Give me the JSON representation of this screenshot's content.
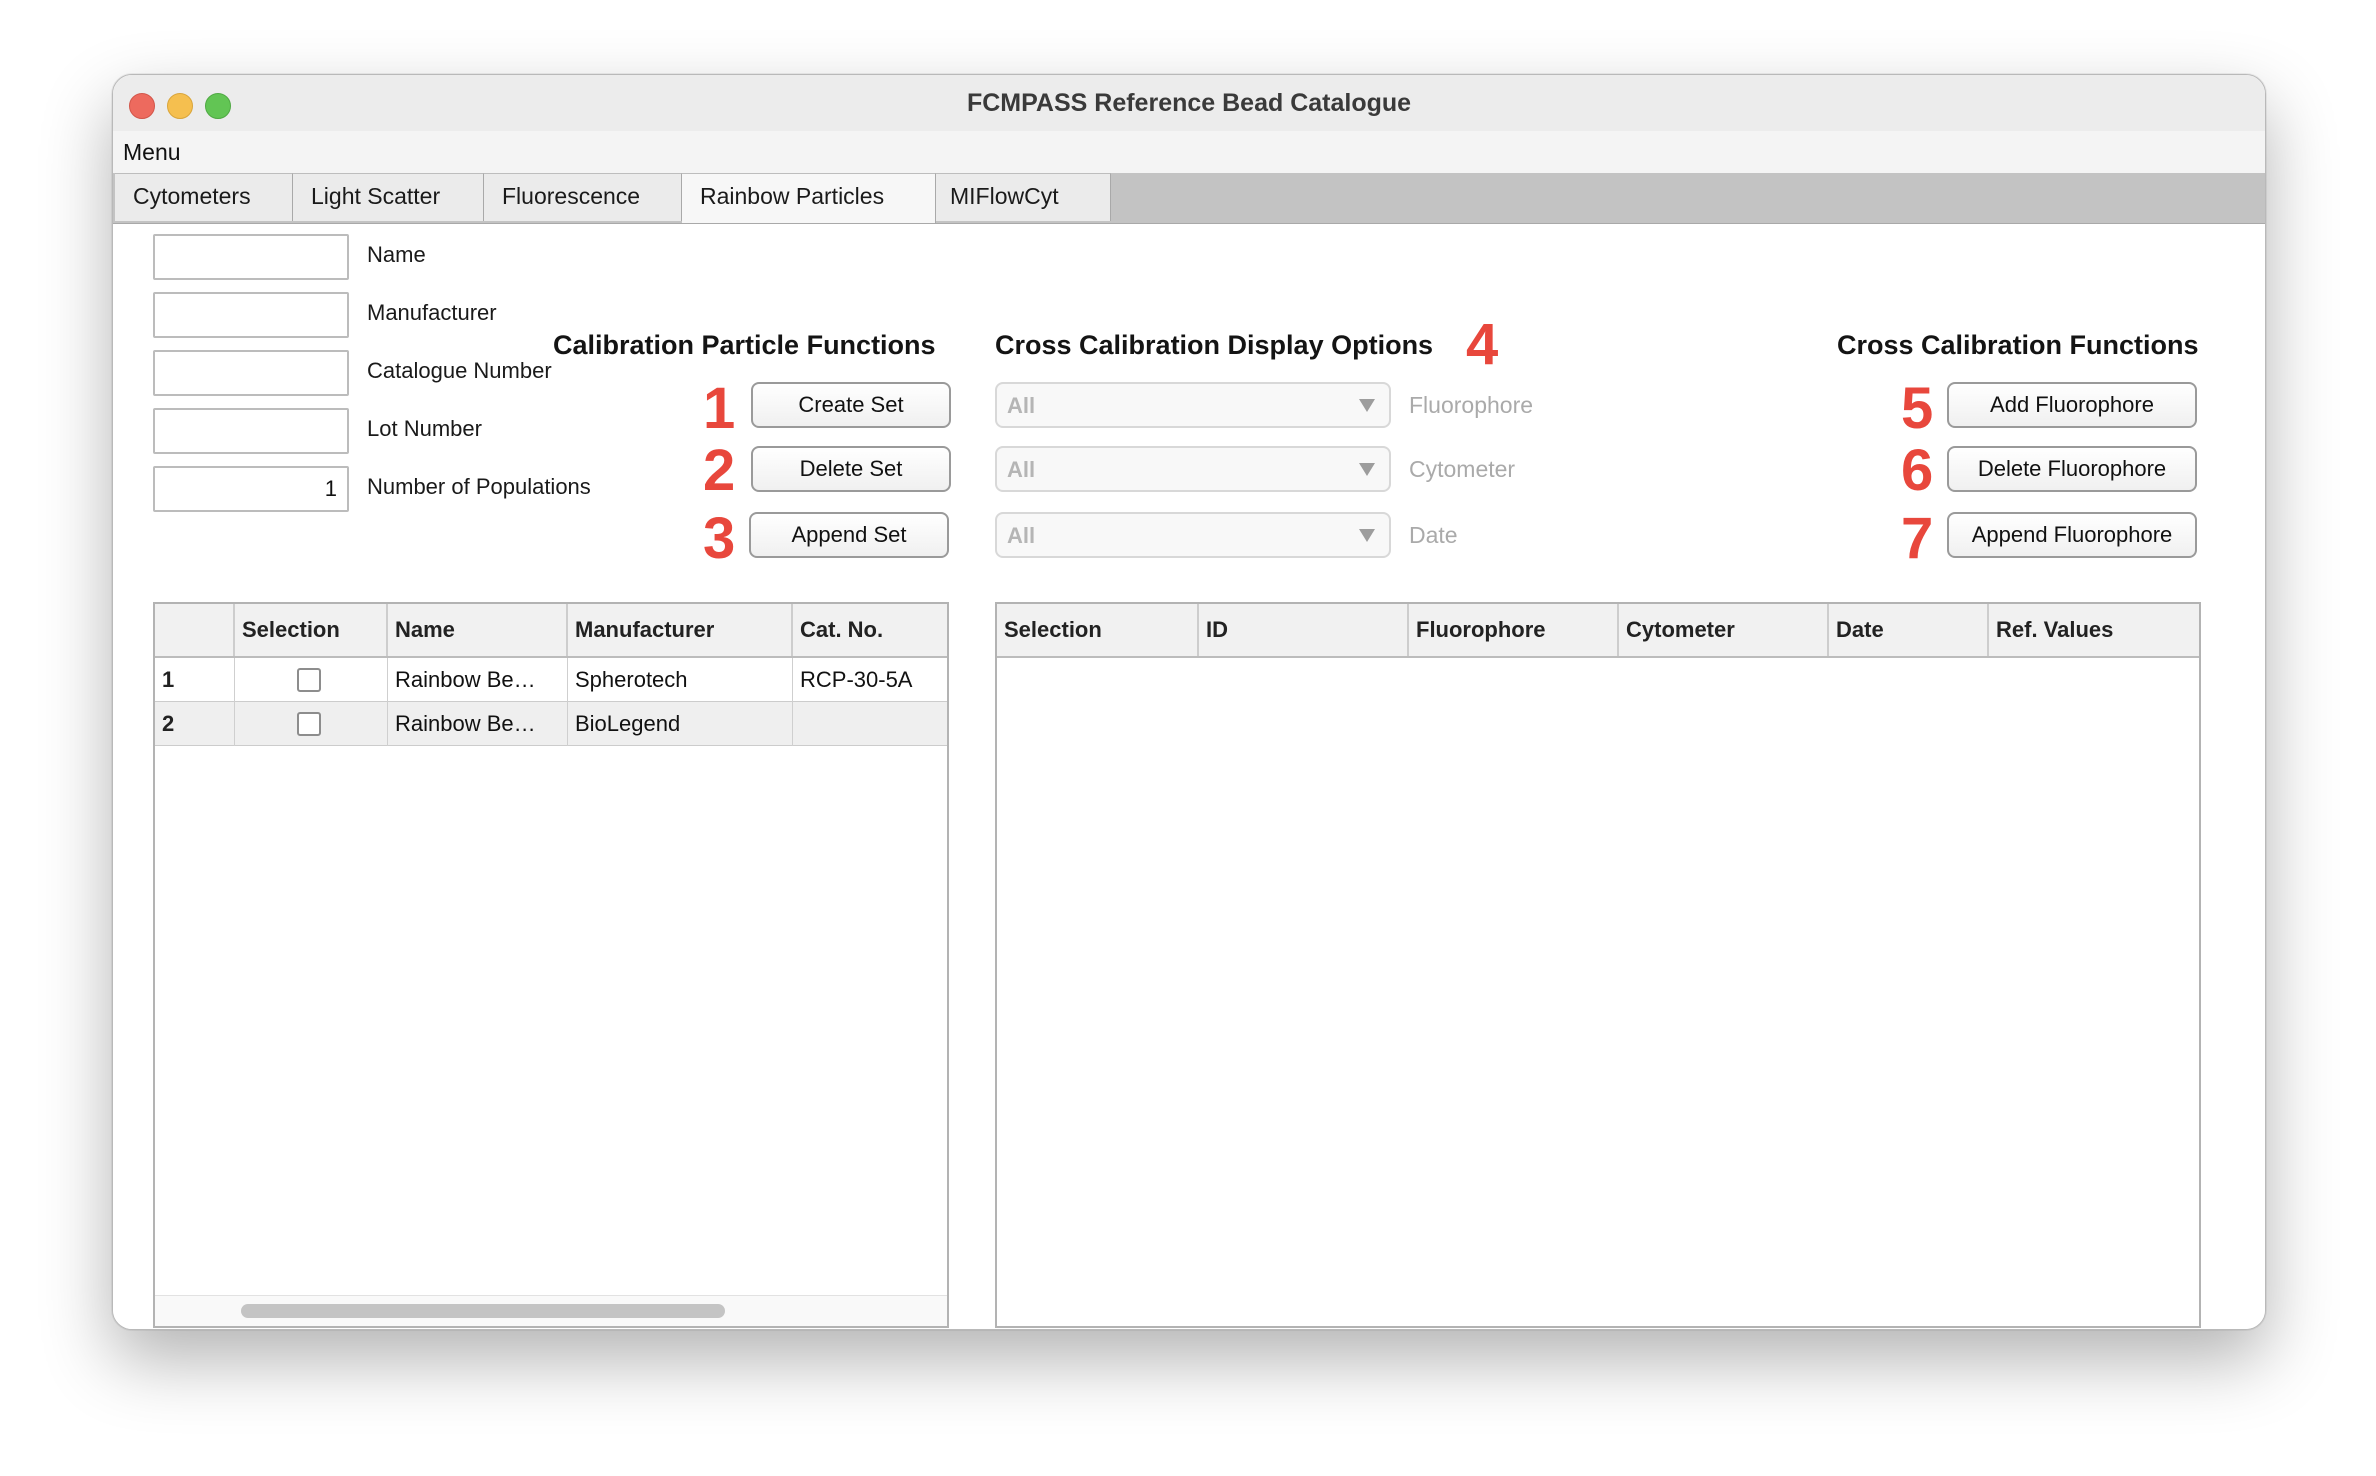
{
  "window": {
    "title": "FCMPASS Reference Bead Catalogue"
  },
  "menu": {
    "label": "Menu"
  },
  "tabs": [
    {
      "label": "Cytometers"
    },
    {
      "label": "Light Scatter"
    },
    {
      "label": "Fluorescence"
    },
    {
      "label": "Rainbow Particles",
      "active": true
    },
    {
      "label": "MIFlowCyt"
    }
  ],
  "form": {
    "name": {
      "label": "Name",
      "value": ""
    },
    "manufacturer": {
      "label": "Manufacturer",
      "value": ""
    },
    "catalogue_number": {
      "label": "Catalogue Number",
      "value": ""
    },
    "lot_number": {
      "label": "Lot Number",
      "value": ""
    },
    "num_populations": {
      "label": "Number of Populations",
      "value": "1"
    }
  },
  "calibration": {
    "title": "Calibration Particle Functions",
    "buttons": [
      {
        "marker": "1",
        "label": "Create Set"
      },
      {
        "marker": "2",
        "label": "Delete Set"
      },
      {
        "marker": "3",
        "label": "Append Set"
      }
    ]
  },
  "display_options": {
    "title": "Cross Calibration Display Options",
    "marker": "4",
    "dropdowns": [
      {
        "value": "All",
        "label": "Fluorophore"
      },
      {
        "value": "All",
        "label": "Cytometer"
      },
      {
        "value": "All",
        "label": "Date"
      }
    ]
  },
  "cross_functions": {
    "title": "Cross Calibration Functions",
    "buttons": [
      {
        "marker": "5",
        "label": "Add Fluorophore"
      },
      {
        "marker": "6",
        "label": "Delete Fluorophore"
      },
      {
        "marker": "7",
        "label": "Append Fluorophore"
      }
    ]
  },
  "sets_table": {
    "columns": [
      "",
      "Selection",
      "Name",
      "Manufacturer",
      "Cat. No."
    ],
    "rows": [
      {
        "index": "1",
        "selected": false,
        "name": "Rainbow Be…",
        "manufacturer": "Spherotech",
        "cat_no": "RCP-30-5A"
      },
      {
        "index": "2",
        "selected": false,
        "name": "Rainbow Be…",
        "manufacturer": "BioLegend",
        "cat_no": ""
      }
    ]
  },
  "fluor_table": {
    "columns": [
      "Selection",
      "ID",
      "Fluorophore",
      "Cytometer",
      "Date",
      "Ref. Values"
    ],
    "rows": []
  },
  "colors": {
    "marker_red": "#e8473c",
    "tab_bar": "#c3c3c3",
    "window_bg": "#ffffff"
  }
}
